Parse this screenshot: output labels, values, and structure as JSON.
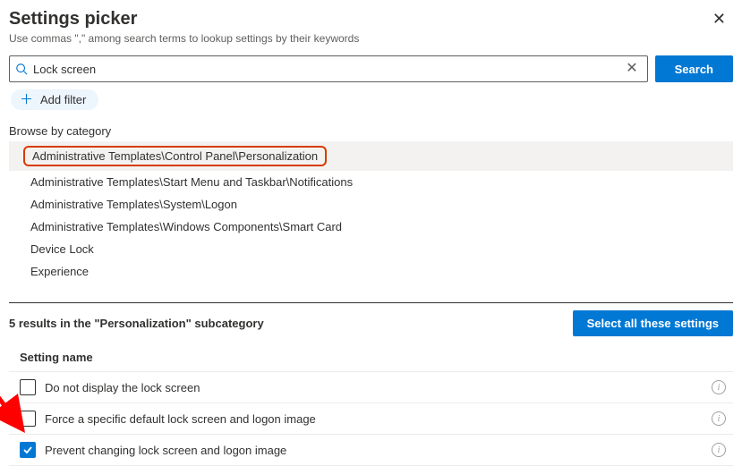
{
  "header": {
    "title": "Settings picker",
    "subtitle": "Use commas \",\" among search terms to lookup settings by their keywords"
  },
  "search": {
    "value": "Lock screen",
    "button": "Search"
  },
  "addFilter": "Add filter",
  "browseLabel": "Browse by category",
  "categories": [
    {
      "label": "Administrative Templates\\Control Panel\\Personalization",
      "selected": true
    },
    {
      "label": "Administrative Templates\\Start Menu and Taskbar\\Notifications",
      "selected": false
    },
    {
      "label": "Administrative Templates\\System\\Logon",
      "selected": false
    },
    {
      "label": "Administrative Templates\\Windows Components\\Smart Card",
      "selected": false
    },
    {
      "label": "Device Lock",
      "selected": false
    },
    {
      "label": "Experience",
      "selected": false
    }
  ],
  "results": {
    "summary": "5 results in the \"Personalization\" subcategory",
    "selectAll": "Select all these settings",
    "columnHeader": "Setting name",
    "items": [
      {
        "label": "Do not display the lock screen",
        "checked": false
      },
      {
        "label": "Force a specific default lock screen and logon image",
        "checked": false
      },
      {
        "label": "Prevent changing lock screen and logon image",
        "checked": true
      }
    ]
  }
}
